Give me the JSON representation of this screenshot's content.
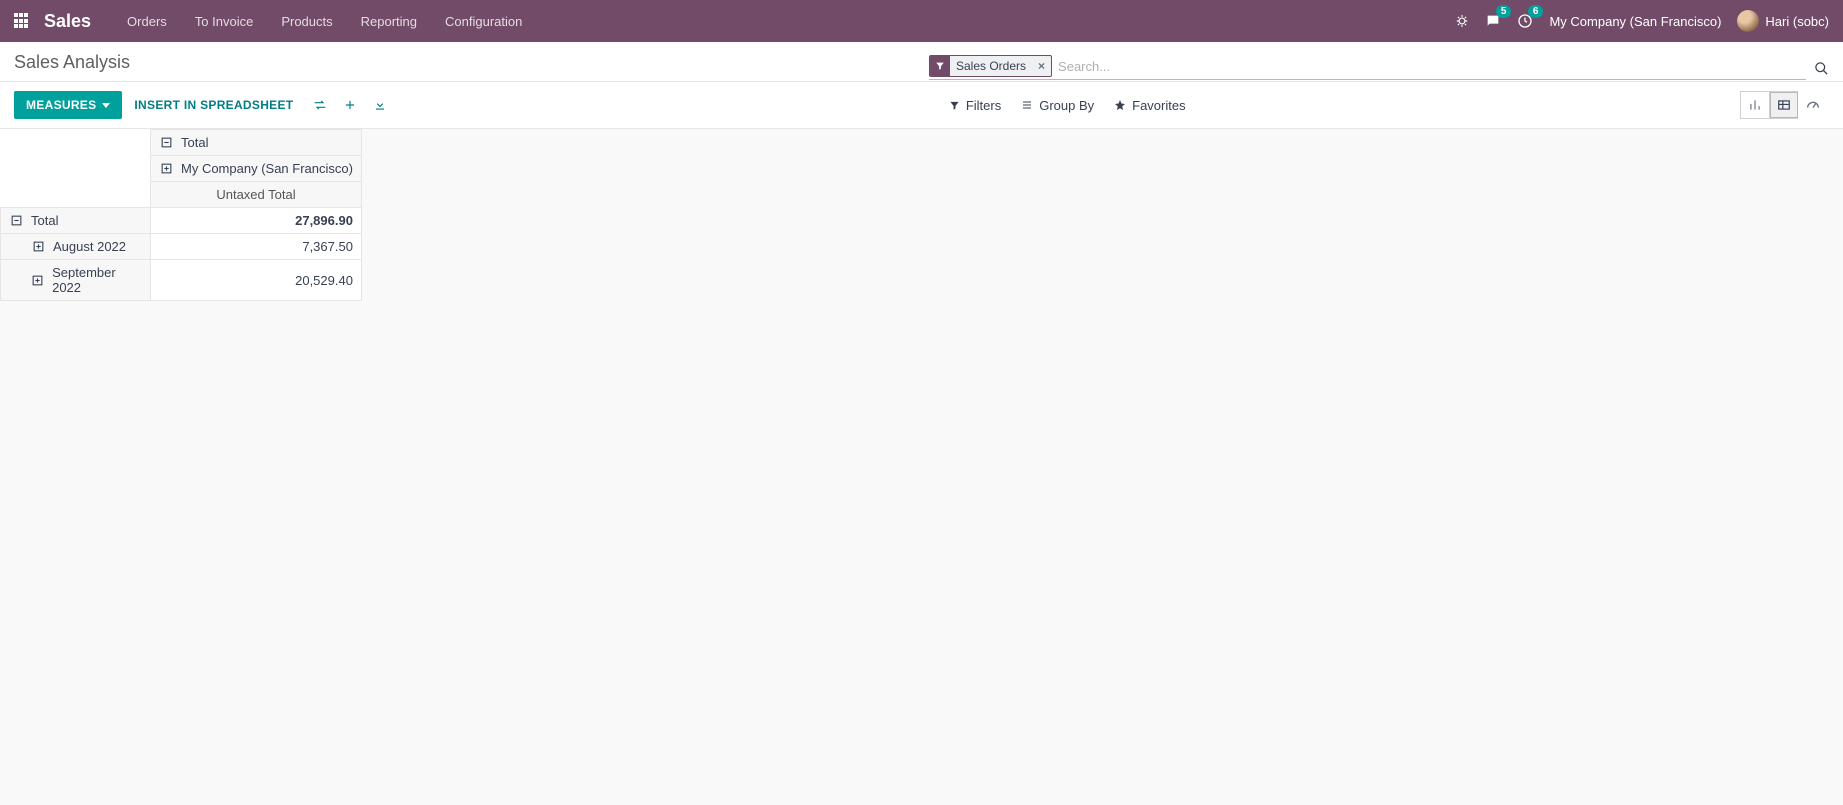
{
  "navbar": {
    "brand": "Sales",
    "links": [
      "Orders",
      "To Invoice",
      "Products",
      "Reporting",
      "Configuration"
    ],
    "messages_badge": "5",
    "activities_badge": "6",
    "company": "My Company (San Francisco)",
    "user": "Hari (sobc)"
  },
  "breadcrumb": {
    "title": "Sales Analysis"
  },
  "search": {
    "facet_label": "Sales Orders",
    "placeholder": "Search..."
  },
  "toolbar": {
    "measures_label": "MEASURES",
    "insert_label": "INSERT IN SPREADSHEET",
    "filters_label": "Filters",
    "groupby_label": "Group By",
    "favorites_label": "Favorites"
  },
  "pivot": {
    "col_group": "Total",
    "col_sub": "My Company (San Francisco)",
    "measure": "Untaxed Total",
    "row_total_label": "Total",
    "row_total_value": "27,896.90",
    "rows": [
      {
        "label": "August 2022",
        "value": "7,367.50"
      },
      {
        "label": "September 2022",
        "value": "20,529.40"
      }
    ]
  }
}
